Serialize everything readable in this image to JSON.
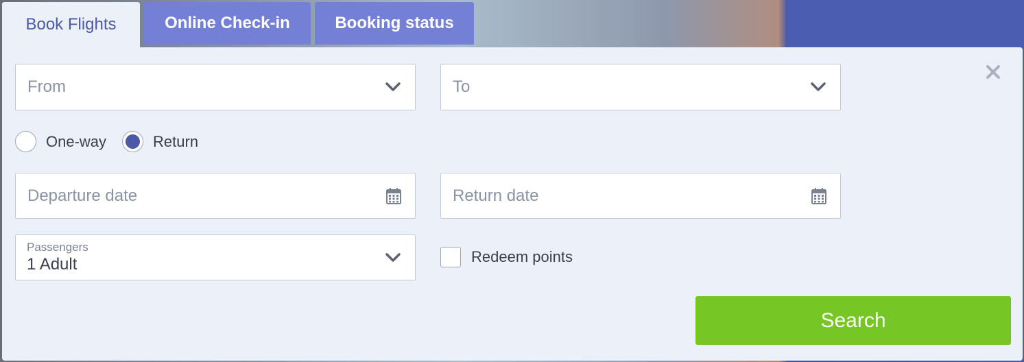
{
  "tabs": [
    {
      "label": "Book Flights",
      "active": true
    },
    {
      "label": "Online Check-in",
      "active": false
    },
    {
      "label": "Booking status",
      "active": false
    }
  ],
  "form": {
    "from_placeholder": "From",
    "to_placeholder": "To",
    "trip_type": {
      "options": [
        "One-way",
        "Return"
      ],
      "selected": "Return"
    },
    "departure_placeholder": "Departure date",
    "return_placeholder": "Return date",
    "passengers_label": "Passengers",
    "passengers_value": "1 Adult",
    "redeem_label": "Redeem points",
    "redeem_checked": false,
    "search_label": "Search"
  },
  "icons": {
    "dropdown": "chevron-down-icon",
    "calendar": "calendar-icon",
    "close": "close-icon"
  },
  "colors": {
    "accent": "#4a5aa6",
    "tab_inactive": "#7480d6",
    "panel_bg": "#ecf0f8",
    "search_button": "#76c626"
  }
}
